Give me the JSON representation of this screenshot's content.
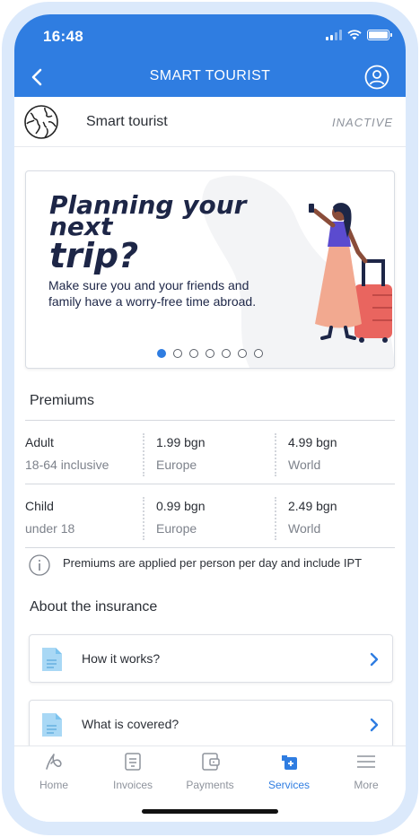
{
  "status_bar": {
    "time": "16:48"
  },
  "header": {
    "title": "SMART TOURIST"
  },
  "product": {
    "name": "Smart tourist",
    "state": "INACTIVE"
  },
  "banner": {
    "title_line1": "Planning your",
    "title_line2": "next",
    "title_line3": "trip?",
    "text": "Make sure you and your friends and family have a worry-free time abroad.",
    "slide_count": 7,
    "active_slide": 1
  },
  "premiums": {
    "title": "Premiums",
    "rows": [
      {
        "label": "Adult",
        "sublabel": "18-64 inclusive",
        "price1": "1.99 bgn",
        "region1": "Europe",
        "price2": "4.99 bgn",
        "region2": "World"
      },
      {
        "label": "Child",
        "sublabel": "under 18",
        "price1": "0.99 bgn",
        "region1": "Europe",
        "price2": "2.49 bgn",
        "region2": "World"
      }
    ],
    "note": "Premiums are applied per person per day and include IPT"
  },
  "about": {
    "title": "About the insurance",
    "items": [
      {
        "label": "How it works?"
      },
      {
        "label": "What is covered?"
      }
    ]
  },
  "tabbar": {
    "items": [
      {
        "label": "Home",
        "icon": "home-icon"
      },
      {
        "label": "Invoices",
        "icon": "invoice-icon"
      },
      {
        "label": "Payments",
        "icon": "payments-icon"
      },
      {
        "label": "Services",
        "icon": "services-icon",
        "active": true
      },
      {
        "label": "More",
        "icon": "menu-icon"
      }
    ]
  },
  "colors": {
    "brand": "#2f7de1",
    "navy": "#1d2647",
    "luggage": "#e9655f"
  }
}
